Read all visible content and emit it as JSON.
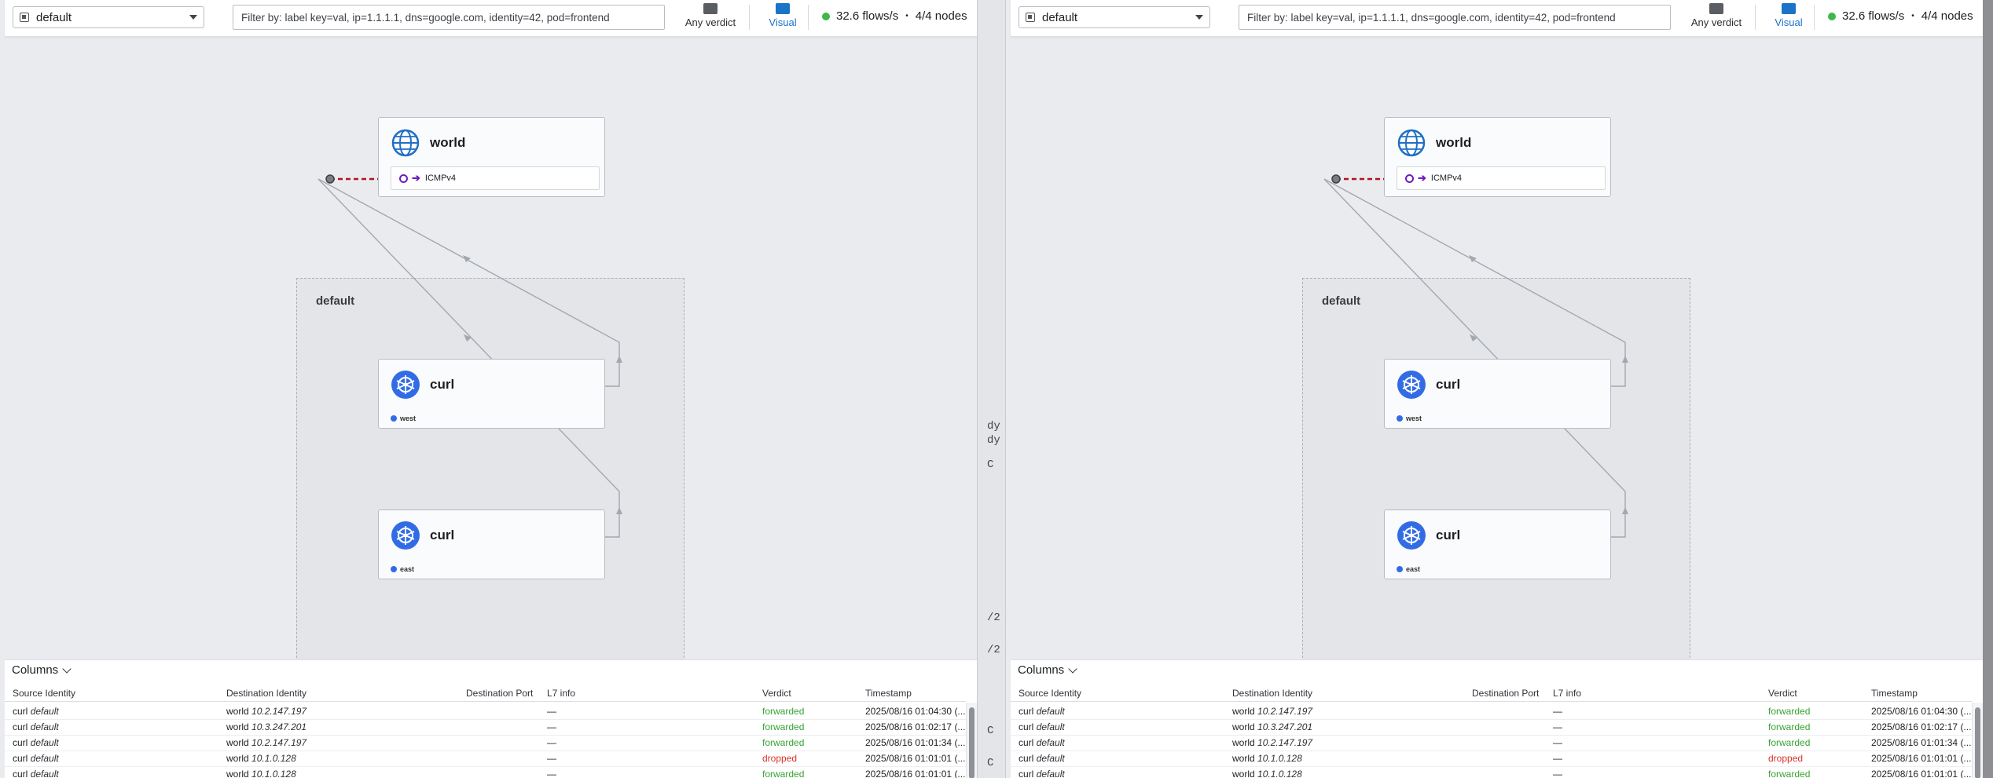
{
  "panels": [
    {
      "namespace": "default",
      "filter_placeholder": "Filter by: label key=val, ip=1.1.1.1, dns=google.com, identity=42, pod=frontend",
      "verdict_label": "Any verdict",
      "visual_label": "Visual",
      "flows_rate": "32.6 flows/s",
      "nodes": "4/4 nodes",
      "graph": {
        "namespace_box_label": "default",
        "world_card": {
          "title": "world",
          "port": "ICMPv4"
        },
        "curl_west": {
          "title": "curl",
          "namespace": "west"
        },
        "curl_east": {
          "title": "curl",
          "namespace": "east"
        }
      },
      "flows": {
        "columns_label": "Columns",
        "headers": [
          "Source Identity",
          "Destination Identity",
          "Destination Port",
          "L7 info",
          "Verdict",
          "Timestamp"
        ],
        "rows": [
          {
            "src": "curl",
            "src_ns": "default",
            "dst": "world",
            "dst_ip": "10.2.147.197",
            "port": "",
            "l7": "—",
            "verdict": "forwarded",
            "ts": "2025/08/16 01:04:30 (..."
          },
          {
            "src": "curl",
            "src_ns": "default",
            "dst": "world",
            "dst_ip": "10.3.247.201",
            "port": "",
            "l7": "—",
            "verdict": "forwarded",
            "ts": "2025/08/16 01:02:17 (..."
          },
          {
            "src": "curl",
            "src_ns": "default",
            "dst": "world",
            "dst_ip": "10.2.147.197",
            "port": "",
            "l7": "—",
            "verdict": "forwarded",
            "ts": "2025/08/16 01:01:34 (..."
          },
          {
            "src": "curl",
            "src_ns": "default",
            "dst": "world",
            "dst_ip": "10.1.0.128",
            "port": "",
            "l7": "—",
            "verdict": "dropped",
            "ts": "2025/08/16 01:01:01 (..."
          },
          {
            "src": "curl",
            "src_ns": "default",
            "dst": "world",
            "dst_ip": "10.1.0.128",
            "port": "",
            "l7": "—",
            "verdict": "forwarded",
            "ts": "2025/08/16 01:01:01 (..."
          }
        ]
      }
    },
    {
      "namespace": "default",
      "filter_placeholder": "Filter by: label key=val, ip=1.1.1.1, dns=google.com, identity=42, pod=frontend",
      "verdict_label": "Any verdict",
      "visual_label": "Visual",
      "flows_rate": "32.6 flows/s",
      "nodes": "4/4 nodes",
      "graph": {
        "namespace_box_label": "default",
        "world_card": {
          "title": "world",
          "port": "ICMPv4"
        },
        "curl_west": {
          "title": "curl",
          "namespace": "west"
        },
        "curl_east": {
          "title": "curl",
          "namespace": "east"
        }
      },
      "flows": {
        "columns_label": "Columns",
        "headers": [
          "Source Identity",
          "Destination Identity",
          "Destination Port",
          "L7 info",
          "Verdict",
          "Timestamp"
        ],
        "rows": [
          {
            "src": "curl",
            "src_ns": "default",
            "dst": "world",
            "dst_ip": "10.2.147.197",
            "port": "",
            "l7": "—",
            "verdict": "forwarded",
            "ts": "2025/08/16 01:04:30 (..."
          },
          {
            "src": "curl",
            "src_ns": "default",
            "dst": "world",
            "dst_ip": "10.3.247.201",
            "port": "",
            "l7": "—",
            "verdict": "forwarded",
            "ts": "2025/08/16 01:02:17 (..."
          },
          {
            "src": "curl",
            "src_ns": "default",
            "dst": "world",
            "dst_ip": "10.2.147.197",
            "port": "",
            "l7": "—",
            "verdict": "forwarded",
            "ts": "2025/08/16 01:01:34 (..."
          },
          {
            "src": "curl",
            "src_ns": "default",
            "dst": "world",
            "dst_ip": "10.1.0.128",
            "port": "",
            "l7": "—",
            "verdict": "dropped",
            "ts": "2025/08/16 01:01:01 (..."
          },
          {
            "src": "curl",
            "src_ns": "default",
            "dst": "world",
            "dst_ip": "10.1.0.128",
            "port": "",
            "l7": "—",
            "verdict": "forwarded",
            "ts": "2025/08/16 01:01:01 (..."
          }
        ]
      }
    }
  ],
  "divider_fragments": [
    "dy",
    "dy",
    "C",
    "/2",
    "/2",
    "C",
    "C"
  ],
  "colors": {
    "forwarded": "#37a333",
    "dropped": "#d9342b",
    "accent": "#1a73c7",
    "dropped_link": "#b3121c",
    "k8s_blue": "#326ce5"
  }
}
